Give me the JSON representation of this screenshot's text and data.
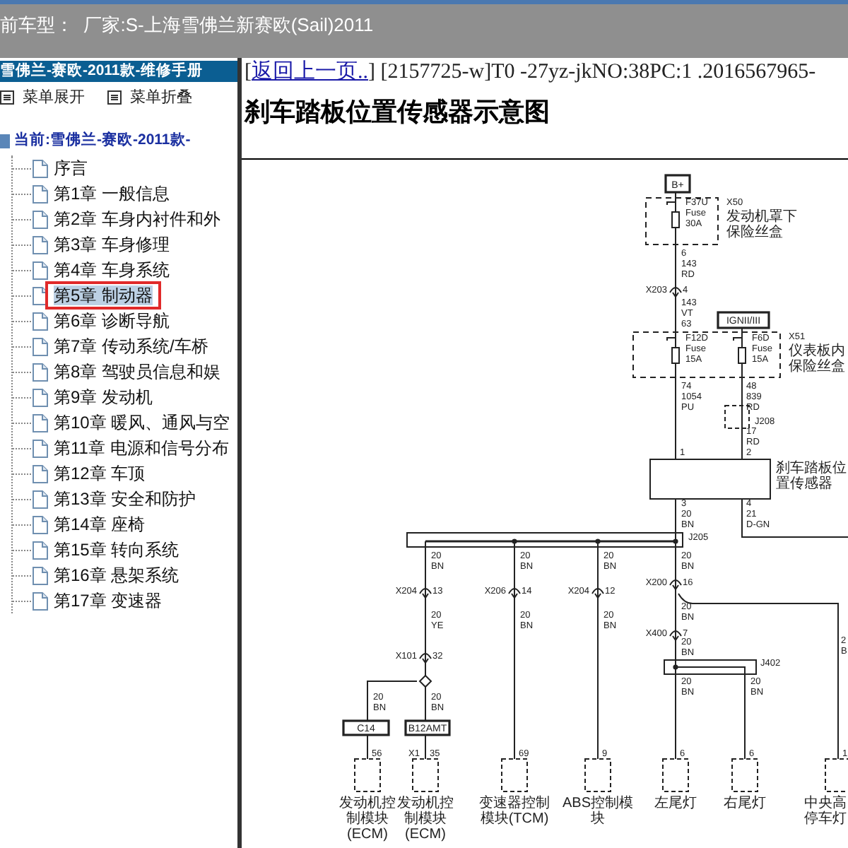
{
  "header": {
    "title": "前车型：  厂家:S-上海雪佛兰新赛欧(Sail)2011"
  },
  "sidebar": {
    "title": "雪佛兰-赛欧-2011款-维修手册",
    "menu_buttons": [
      "菜单展开",
      "菜单折叠"
    ],
    "tree": {
      "root": "当前:雪佛兰-赛欧-2011款-",
      "items": [
        {
          "label": "序言",
          "selected": false
        },
        {
          "label": "第1章 一般信息",
          "selected": false
        },
        {
          "label": "第2章 车身内衬件和外",
          "selected": false
        },
        {
          "label": "第3章 车身修理",
          "selected": false
        },
        {
          "label": "第4章 车身系统",
          "selected": false
        },
        {
          "label": "第5章 制动器",
          "selected": true
        },
        {
          "label": "第6章 诊断导航",
          "selected": false
        },
        {
          "label": "第7章 传动系统/车桥",
          "selected": false
        },
        {
          "label": "第8章 驾驶员信息和娱",
          "selected": false
        },
        {
          "label": "第9章 发动机",
          "selected": false
        },
        {
          "label": "第10章 暖风、通风与空",
          "selected": false
        },
        {
          "label": "第11章 电源和信号分布",
          "selected": false
        },
        {
          "label": "第12章 车顶",
          "selected": false
        },
        {
          "label": "第13章 安全和防护",
          "selected": false
        },
        {
          "label": "第14章 座椅",
          "selected": false
        },
        {
          "label": "第15章 转向系统",
          "selected": false
        },
        {
          "label": "第16章 悬架系统",
          "selected": false
        },
        {
          "label": "第17章 变速器",
          "selected": false
        }
      ]
    }
  },
  "content": {
    "nav": {
      "prefix": "[",
      "link": "返回上一页..",
      "suffix": "] [2157725-w]T0 -27yz-jkNO:38PC:1 .2016567965-"
    },
    "heading": "刹车踏板位置传感器示意图",
    "diagram": {
      "power": [
        "B+",
        "IGNII/III"
      ],
      "fuse_blocks": [
        {
          "connector": "X50",
          "caption": "发动机罩下保险丝盒",
          "fuses": [
            {
              "name": "F37U",
              "type": "Fuse",
              "rating": "30A"
            }
          ]
        },
        {
          "connector": "X51",
          "caption": "仪表板内保险丝盒",
          "fuses": [
            {
              "name": "F12D",
              "type": "Fuse",
              "rating": "15A"
            },
            {
              "name": "F6D",
              "type": "Fuse",
              "rating": "15A"
            }
          ]
        }
      ],
      "splices": [
        "J208",
        "J205",
        "J402"
      ],
      "component": {
        "caption": "刹车踏板位置传感器",
        "pins": [
          "1",
          "2"
        ]
      },
      "inline_connectors": [
        {
          "name": "X203",
          "pin": "4"
        },
        {
          "name": "X204",
          "pin": "13"
        },
        {
          "name": "X206",
          "pin": "14"
        },
        {
          "name": "X204",
          "pin": "12"
        },
        {
          "name": "X200",
          "pin": "16"
        },
        {
          "name": "X101",
          "pin": "32"
        },
        {
          "name": "X400",
          "pin": "7"
        }
      ],
      "wire_labels": [
        [
          "6",
          "143",
          "RD"
        ],
        [
          "143",
          "VT",
          "63"
        ],
        [
          "74",
          "1054",
          "PU"
        ],
        [
          "48",
          "839",
          "RD"
        ],
        [
          "17",
          "RD"
        ],
        [
          "3",
          "20",
          "BN"
        ],
        [
          "4",
          "21",
          "D-GN"
        ],
        [
          "20",
          "BN"
        ],
        [
          "20",
          "BN"
        ],
        [
          "20",
          "BN"
        ],
        [
          "20",
          "BN"
        ],
        [
          "20",
          "YE"
        ],
        [
          "20",
          "BN"
        ],
        [
          "20",
          "BN"
        ],
        [
          "20",
          "BN"
        ],
        [
          "20",
          "BN"
        ],
        [
          "20",
          "BN"
        ],
        [
          "20",
          "BN"
        ],
        [
          "20",
          "BN"
        ],
        [
          "20",
          "BN"
        ],
        [
          "2",
          "B"
        ]
      ],
      "harness_connectors": [
        "C14",
        "B12AMT"
      ],
      "modules": [
        {
          "caption": "发动机控制模块(ECM)",
          "pins": [
            "56"
          ]
        },
        {
          "caption": "发动机控制模块(ECM)",
          "pins": [
            "X1",
            "35"
          ]
        },
        {
          "caption": "变速器控制模块(TCM)",
          "pins": [
            "69"
          ]
        },
        {
          "caption": "ABS控制模块",
          "pins": [
            "9"
          ]
        },
        {
          "caption": "左尾灯",
          "pins": [
            "6"
          ]
        },
        {
          "caption": "右尾灯",
          "pins": [
            "6"
          ]
        },
        {
          "caption": "中央高停车灯",
          "pins": [
            "1"
          ]
        }
      ]
    }
  }
}
